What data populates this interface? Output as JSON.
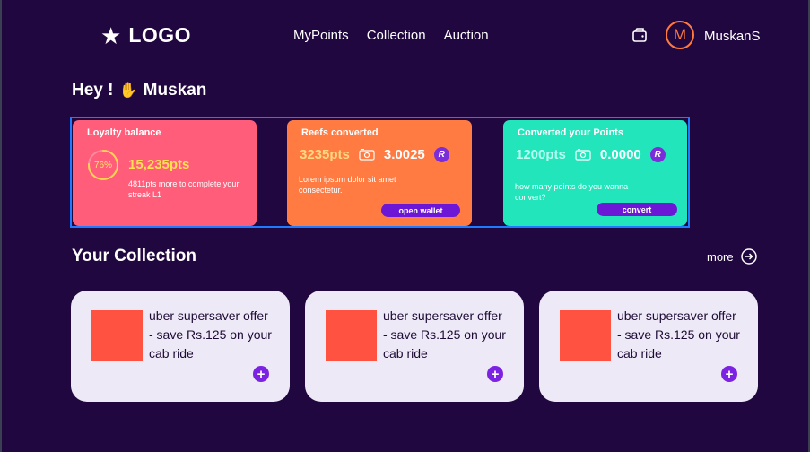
{
  "header": {
    "logo_text": "LOGO",
    "nav": [
      "MyPoints",
      "Collection",
      "Auction"
    ],
    "avatar_initial": "M",
    "username": "MuskanS"
  },
  "greeting": {
    "text": "Hey !",
    "name": "Muskan"
  },
  "cards": {
    "loyalty": {
      "title": "Loyalty balance",
      "percent_label": "76%",
      "percent_value": 0.76,
      "points": "15,235pts",
      "note": "4811pts more to complete your streak L1"
    },
    "reefs": {
      "title": "Reefs  converted",
      "points": "3235pts",
      "token_value": "3.0025",
      "description": "Lorem ipsum dolor sit amet consectetur.",
      "button": "open wallet"
    },
    "convert": {
      "title": "Converted your Points",
      "points": "1200pts",
      "token_value": "0.0000",
      "question": "how many points do you wanna convert?",
      "button": "convert"
    }
  },
  "collection": {
    "title": "Your Collection",
    "more_label": "more",
    "items": [
      {
        "text": "uber supersaver offer - save Rs.125 on your cab ride"
      },
      {
        "text": "uber supersaver offer - save Rs.125 on your cab ride"
      },
      {
        "text": "uber supersaver offer - save Rs.125 on your cab ride"
      }
    ]
  },
  "colors": {
    "background": "#21073f",
    "loyalty_card": "#ff5d7a",
    "reefs_card": "#ff7b42",
    "convert_card": "#23e5bb",
    "accent_purple": "#6d17d6",
    "thumb": "#ff5240"
  },
  "icons": [
    "star-icon",
    "wallet-icon",
    "wave-hand-icon",
    "swap-icon",
    "token-icon",
    "arrow-right-circle-icon",
    "plus-icon"
  ]
}
